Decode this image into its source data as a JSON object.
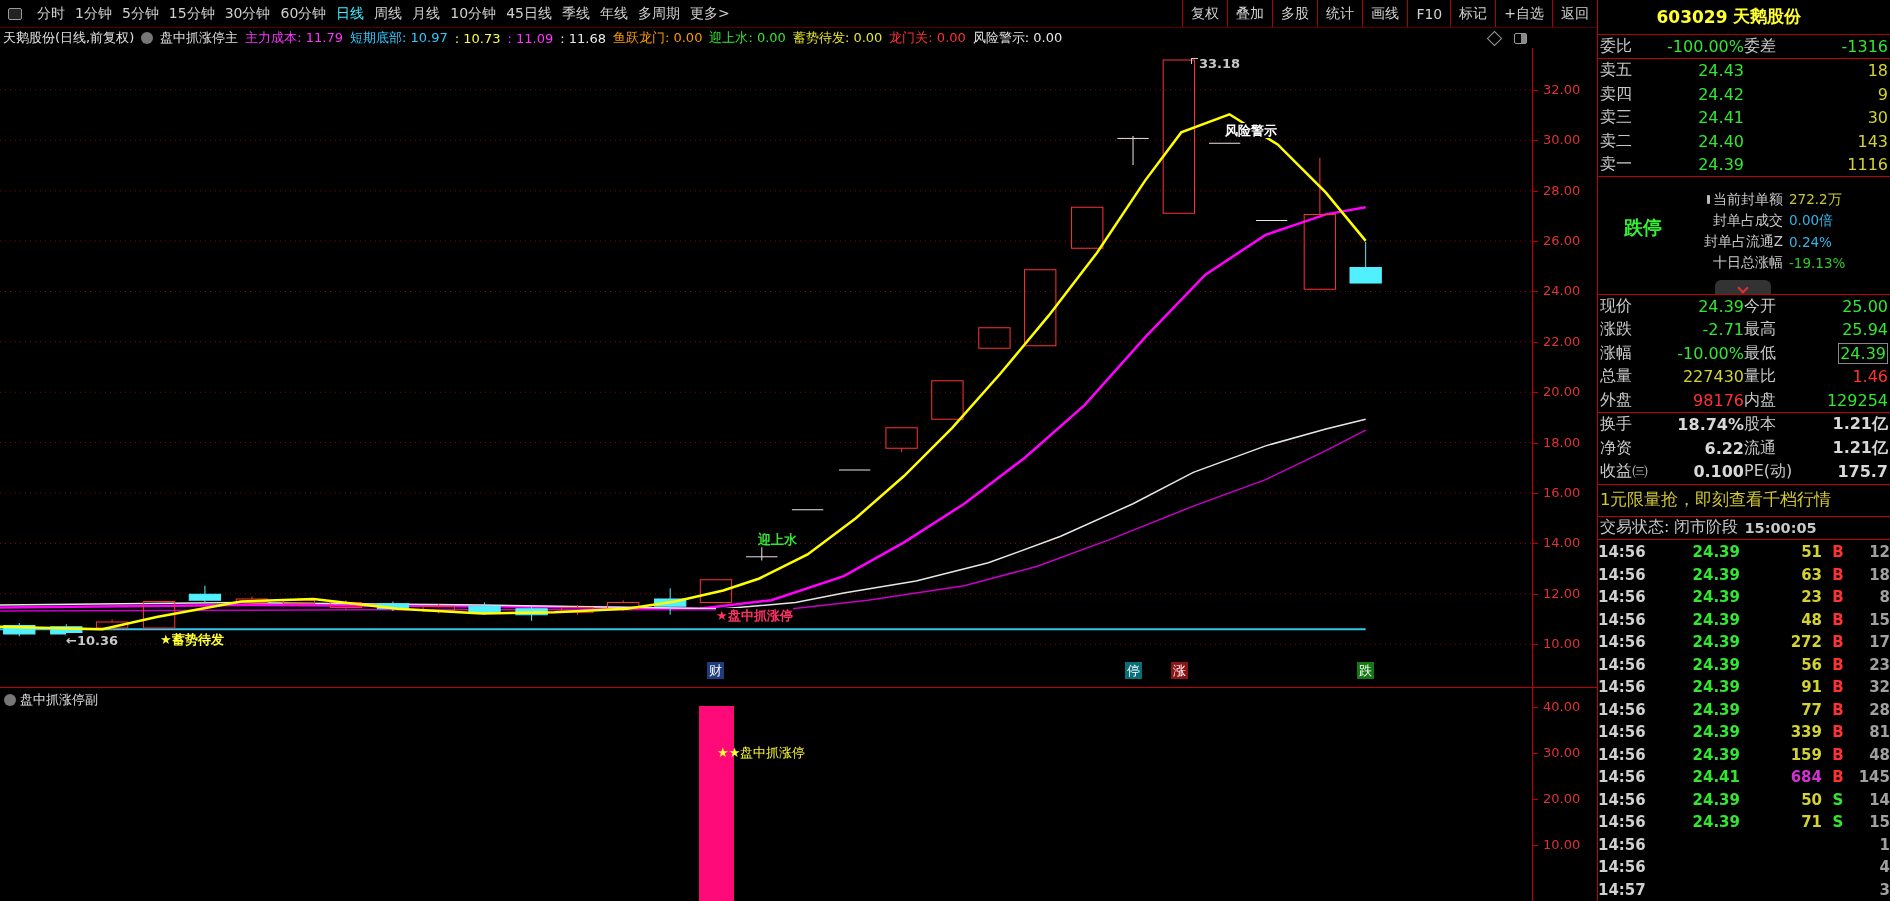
{
  "toolbar": {
    "periods": [
      {
        "label": "分时",
        "selected": false
      },
      {
        "label": "1分钟",
        "selected": false
      },
      {
        "label": "5分钟",
        "selected": false
      },
      {
        "label": "15分钟",
        "selected": false
      },
      {
        "label": "30分钟",
        "selected": false
      },
      {
        "label": "60分钟",
        "selected": false
      },
      {
        "label": "日线",
        "selected": true
      },
      {
        "label": "周线",
        "selected": false
      },
      {
        "label": "月线",
        "selected": false
      },
      {
        "label": "10分钟",
        "selected": false
      },
      {
        "label": "45日线",
        "selected": false
      },
      {
        "label": "季线",
        "selected": false
      },
      {
        "label": "年线",
        "selected": false
      },
      {
        "label": "多周期",
        "selected": false
      },
      {
        "label": "更多>",
        "selected": false
      }
    ],
    "buttons": [
      "复权",
      "叠加",
      "多股",
      "统计",
      "画线",
      "F10",
      "标记",
      "+自选",
      "返回"
    ]
  },
  "chart_info": {
    "title": "天鹅股份(日线,前复权)",
    "indicator": "盘中抓涨停主",
    "values": [
      {
        "text": "主力成本: 11.79",
        "color": "#ff32ff"
      },
      {
        "text": "短期底部: 10.97",
        "color": "#32c8ff"
      },
      {
        "text": ": 10.73",
        "color": "#ffff32"
      },
      {
        "text": ": 11.09",
        "color": "#ff32ff"
      },
      {
        "text": ": 11.68",
        "color": "#e6e6e6"
      },
      {
        "text": "鱼跃龙门: 0.00",
        "color": "#ff9900"
      },
      {
        "text": "迎上水: 0.00",
        "color": "#32e632"
      },
      {
        "text": "蓄势待发: 0.00",
        "color": "#e6e632"
      },
      {
        "text": "龙门关: 0.00",
        "color": "#ff3232"
      },
      {
        "text": "风险警示: 0.00",
        "color": "#e6e6e6"
      }
    ]
  },
  "main_chart": {
    "price_axis": [
      "32.00",
      "30.00",
      "28.00",
      "26.00",
      "24.00",
      "22.00",
      "20.00",
      "18.00",
      "16.00",
      "14.00",
      "12.00",
      "10.00"
    ],
    "annotations": [
      {
        "text": "33.18",
        "kind": "high",
        "color": "#c8c8c8"
      },
      {
        "text": "←10.36",
        "kind": "low",
        "color": "#c8c8c8"
      },
      {
        "text": "风险警示",
        "kind": "label",
        "color": "#ffffff"
      },
      {
        "text": "迎上水",
        "kind": "label",
        "color": "#32e632"
      },
      {
        "text": "★蓄势待发",
        "kind": "label",
        "color": "#ffff32"
      },
      {
        "text": "★盘中抓涨停",
        "kind": "label",
        "color": "#ff3264"
      }
    ],
    "signals": [
      {
        "text": "财",
        "color": "#1e3c78"
      },
      {
        "text": "停",
        "color": "#0a6e78"
      },
      {
        "text": "涨",
        "color": "#8c1414"
      },
      {
        "text": "跌",
        "color": "#147814"
      }
    ]
  },
  "sub_chart": {
    "title": "盘中抓涨停副",
    "axis": [
      "40.00",
      "30.00",
      "20.00",
      "10.00"
    ],
    "annotation": "★★盘中抓涨停"
  },
  "quote_panel": {
    "code": "603029",
    "name": "天鹅股份",
    "weibi": {
      "label": "委比",
      "value": "-100.00%",
      "label2": "委差",
      "value2": "-1316"
    },
    "asks": [
      {
        "label": "卖五",
        "price": "24.43",
        "volume": "18"
      },
      {
        "label": "卖四",
        "price": "24.42",
        "volume": "9"
      },
      {
        "label": "卖三",
        "price": "24.41",
        "volume": "30"
      },
      {
        "label": "卖二",
        "price": "24.40",
        "volume": "143"
      },
      {
        "label": "卖一",
        "price": "24.39",
        "volume": "1116"
      }
    ],
    "limit_status": "跌停",
    "limit_info": [
      {
        "label": "当前封单额",
        "value": "272.2万",
        "color": "#c8c832"
      },
      {
        "label": "封单占成交",
        "value": "0.00倍",
        "color": "#32b4e6"
      },
      {
        "label": "封单占流通Z",
        "value": "0.24%",
        "color": "#32b4e6"
      },
      {
        "label": "十日总涨幅",
        "value": "-19.13%",
        "color": "#32c832"
      }
    ],
    "stats": [
      {
        "left": {
          "label": "现价",
          "value": "24.39",
          "color": "#32e632"
        },
        "right": {
          "label": "今开",
          "value": "25.00",
          "color": "#32e632",
          "highlighted": false
        }
      },
      {
        "left": {
          "label": "涨跌",
          "value": "-2.71",
          "color": "#32e632"
        },
        "right": {
          "label": "最高",
          "value": "25.94",
          "color": "#32e632",
          "highlighted": false
        }
      },
      {
        "left": {
          "label": "涨幅",
          "value": "-10.00%",
          "color": "#32e632"
        },
        "right": {
          "label": "最低",
          "value": "24.39",
          "color": "#32e632",
          "highlighted": true
        }
      },
      {
        "left": {
          "label": "总量",
          "value": "227430",
          "color": "#d2d232"
        },
        "right": {
          "label": "量比",
          "value": "1.46",
          "color": "#ff3232",
          "highlighted": false
        }
      },
      {
        "left": {
          "label": "外盘",
          "value": "98176",
          "color": "#ff3232"
        },
        "right": {
          "label": "内盘",
          "value": "129254",
          "color": "#32e632",
          "highlighted": false
        }
      }
    ],
    "fundamentals": [
      {
        "label": "换手",
        "value": "18.74%",
        "label2": "股本",
        "value2": "1.21亿"
      },
      {
        "label": "净资",
        "value": "6.22",
        "label2": "流通",
        "value2": "1.21亿"
      },
      {
        "label": "收益㈢",
        "value": "0.100",
        "label2": "PE(动)",
        "value2": "175.7"
      }
    ],
    "promo": "1元限量抢，即刻查看千档行情",
    "trade_status": "交易状态: 闭市阶段",
    "trade_time": "15:00:05",
    "trades": [
      {
        "time": "14:56",
        "price": "24.39",
        "volume": "51",
        "side": "B",
        "kind": "buy",
        "count": "12",
        "large": false
      },
      {
        "time": "14:56",
        "price": "24.39",
        "volume": "63",
        "side": "B",
        "kind": "buy",
        "count": "18",
        "large": false
      },
      {
        "time": "14:56",
        "price": "24.39",
        "volume": "23",
        "side": "B",
        "kind": "buy",
        "count": "8",
        "large": false
      },
      {
        "time": "14:56",
        "price": "24.39",
        "volume": "48",
        "side": "B",
        "kind": "buy",
        "count": "15",
        "large": false
      },
      {
        "time": "14:56",
        "price": "24.39",
        "volume": "272",
        "side": "B",
        "kind": "buy",
        "count": "17",
        "large": false
      },
      {
        "time": "14:56",
        "price": "24.39",
        "volume": "56",
        "side": "B",
        "kind": "buy",
        "count": "23",
        "large": false
      },
      {
        "time": "14:56",
        "price": "24.39",
        "volume": "91",
        "side": "B",
        "kind": "buy",
        "count": "32",
        "large": false
      },
      {
        "time": "14:56",
        "price": "24.39",
        "volume": "77",
        "side": "B",
        "kind": "buy",
        "count": "28",
        "large": false
      },
      {
        "time": "14:56",
        "price": "24.39",
        "volume": "339",
        "side": "B",
        "kind": "buy",
        "count": "81",
        "large": false
      },
      {
        "time": "14:56",
        "price": "24.39",
        "volume": "159",
        "side": "B",
        "kind": "buy",
        "count": "48",
        "large": false
      },
      {
        "time": "14:56",
        "price": "24.41",
        "volume": "684",
        "side": "B",
        "kind": "buy",
        "count": "145",
        "large": true
      },
      {
        "time": "14:56",
        "price": "24.39",
        "volume": "50",
        "side": "S",
        "kind": "sell",
        "count": "14",
        "large": false
      },
      {
        "time": "14:56",
        "price": "24.39",
        "volume": "71",
        "side": "S",
        "kind": "sell",
        "count": "15",
        "large": false
      },
      {
        "time": "14:56",
        "count": "1"
      },
      {
        "time": "14:56",
        "count": "4"
      },
      {
        "time": "14:57",
        "count": "3"
      }
    ]
  }
}
